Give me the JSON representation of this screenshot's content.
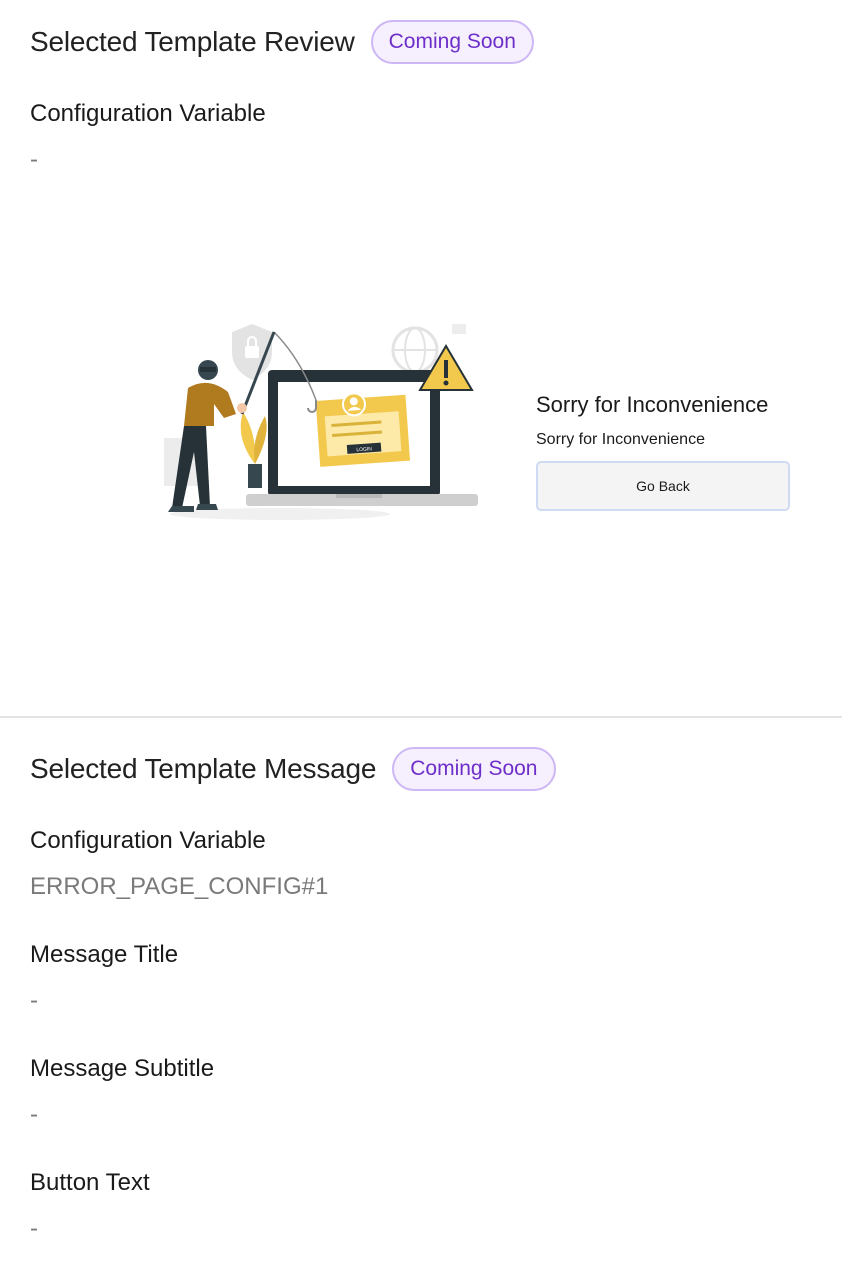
{
  "review": {
    "title": "Selected Template Review",
    "badge": "Coming Soon",
    "config_label": "Configuration Variable",
    "config_value": "-",
    "preview": {
      "title": "Sorry for Inconvenience",
      "subtitle": "Sorry for Inconvenience",
      "button": "Go Back",
      "screen_button": "LOGIN",
      "illustration_icon": "phishing-illustration"
    }
  },
  "message": {
    "title": "Selected Template Message",
    "badge": "Coming Soon",
    "fields": [
      {
        "label": "Configuration Variable",
        "value": "ERROR_PAGE_CONFIG#1"
      },
      {
        "label": "Message Title",
        "value": "-"
      },
      {
        "label": "Message Subtitle",
        "value": "-"
      },
      {
        "label": "Button Text",
        "value": "-"
      }
    ]
  },
  "colors": {
    "badge_border": "#cdb7f4",
    "badge_bg": "#f5effe",
    "badge_text": "#6e2fc9",
    "illustration_accent": "#f2c94c"
  }
}
